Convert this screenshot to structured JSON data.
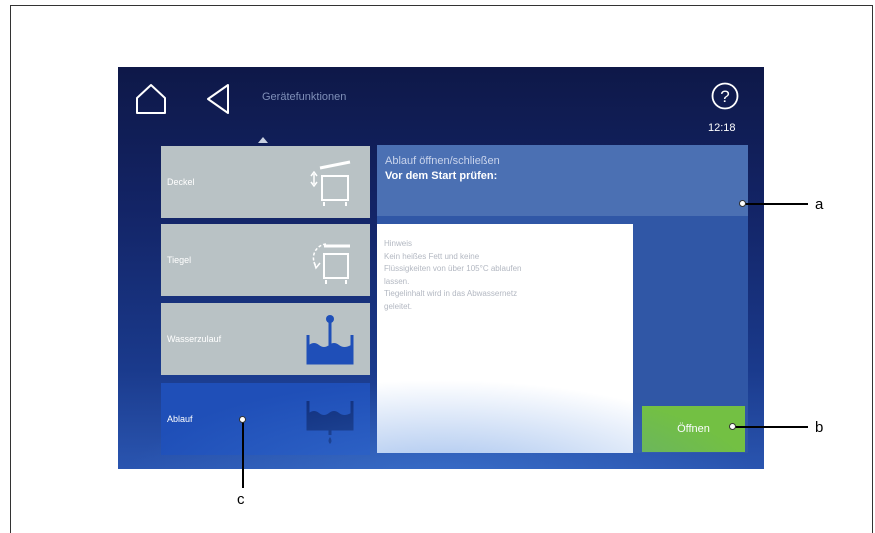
{
  "header": {
    "title": "Gerätefunktionen",
    "clock": "12:18",
    "help_symbol": "?",
    "icons": [
      "home-icon",
      "back-icon",
      "help-icon"
    ]
  },
  "menu": {
    "items": [
      {
        "label": "Deckel",
        "icon": "lid-icon"
      },
      {
        "label": "Tiegel",
        "icon": "pan-tilt-icon"
      },
      {
        "label": "Wasserzulauf",
        "icon": "water-inlet-icon"
      },
      {
        "label": "Ablauf",
        "icon": "drain-icon",
        "selected": true
      }
    ]
  },
  "info": {
    "title": "Ablauf öffnen/schließen",
    "subtitle": "Vor dem Start prüfen:"
  },
  "note": {
    "heading": "Hinweis",
    "line1": "Kein heißes Fett und keine",
    "line2": "Flüssigkeiten von über 105°C ablaufen",
    "line3": "lassen.",
    "line4": "Tiegelinhalt wird in das Abwassernetz",
    "line5": "geleitet."
  },
  "actions": {
    "open_label": "Öffnen"
  },
  "callouts": {
    "a": "a",
    "b": "b",
    "c": "c"
  },
  "colors": {
    "screen_background": "#132466",
    "tile_background": "#b9c2c5",
    "tile_selected": "#1f4fb8",
    "info_panel": "#4b70b3",
    "content_area": "#3057a6",
    "open_button": "#73c043"
  }
}
